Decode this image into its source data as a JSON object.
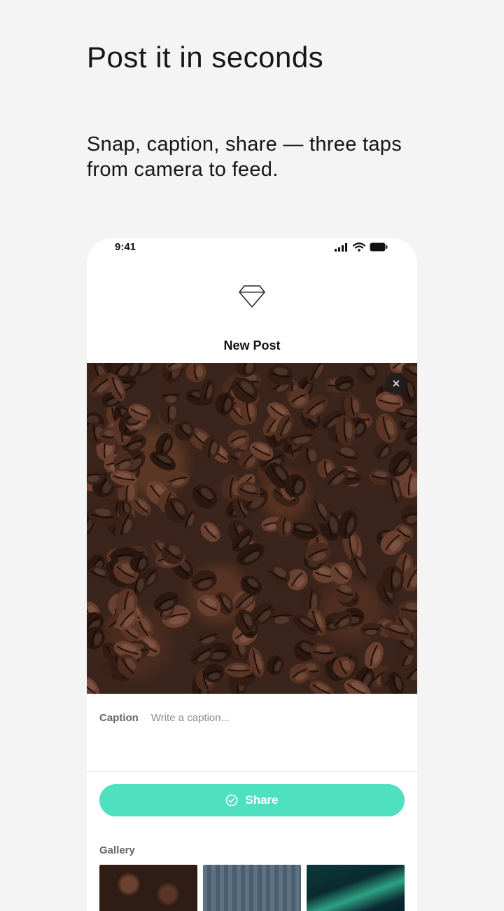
{
  "promo": {
    "headline": "Post it in seconds",
    "subhead": "Snap, caption, share — three taps from camera to feed."
  },
  "statusbar": {
    "time": "9:41",
    "icons": [
      "signal-icon",
      "wifi-icon",
      "battery-icon"
    ]
  },
  "screen": {
    "logo_icon": "diamond-icon",
    "title": "New Post",
    "photo_subject": "coffee beans",
    "close_icon": "close-icon",
    "close_glyph": "×"
  },
  "caption": {
    "label": "Caption",
    "placeholder": "Write a caption...",
    "value": ""
  },
  "share": {
    "label": "Share",
    "icon": "check-circle-icon",
    "color": "#4ee0bf"
  },
  "gallery": {
    "label": "Gallery",
    "items": [
      {
        "subject": "coffee beans"
      },
      {
        "subject": "wooden texture"
      },
      {
        "subject": "aurora"
      }
    ]
  }
}
